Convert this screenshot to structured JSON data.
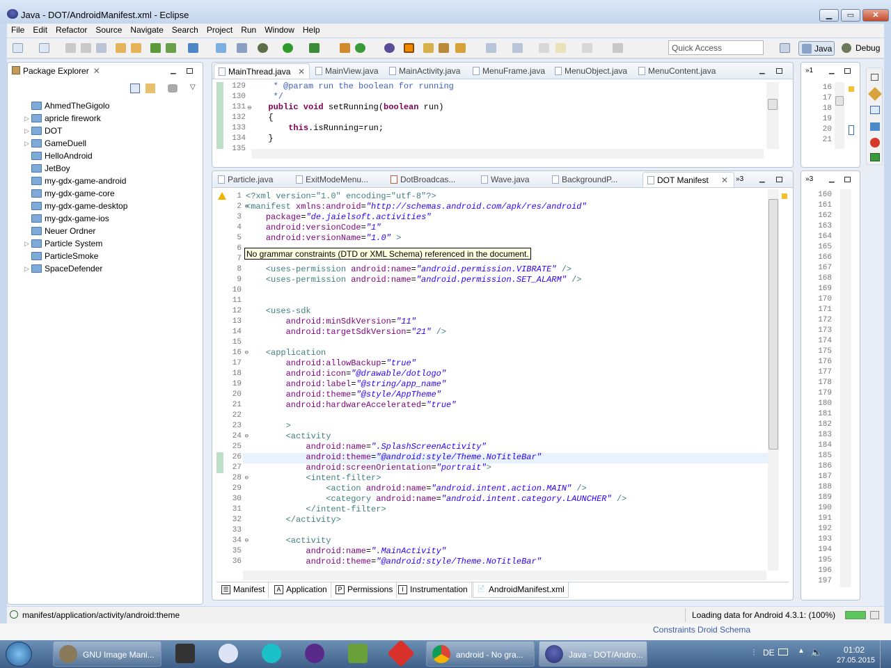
{
  "window": {
    "title": "Java - DOT/AndroidManifest.xml - Eclipse"
  },
  "menu": [
    "File",
    "Edit",
    "Refactor",
    "Source",
    "Navigate",
    "Search",
    "Project",
    "Run",
    "Window",
    "Help"
  ],
  "toolbar": {
    "quick_access": "Quick Access",
    "persp_java": "Java",
    "persp_debug": "Debug"
  },
  "package_explorer": {
    "title": "Package Explorer",
    "items": [
      {
        "label": "AhmedTheGigolo",
        "expandable": false
      },
      {
        "label": "apricle firework",
        "expandable": true
      },
      {
        "label": "DOT",
        "expandable": true
      },
      {
        "label": "GameDuell",
        "expandable": true
      },
      {
        "label": "HelloAndroid",
        "expandable": false
      },
      {
        "label": "JetBoy",
        "expandable": false
      },
      {
        "label": "my-gdx-game-android",
        "expandable": false
      },
      {
        "label": "my-gdx-game-core",
        "expandable": false
      },
      {
        "label": "my-gdx-game-desktop",
        "expandable": false
      },
      {
        "label": "my-gdx-game-ios",
        "expandable": false
      },
      {
        "label": "Neuer Ordner",
        "expandable": false
      },
      {
        "label": "Particle System",
        "expandable": true
      },
      {
        "label": "ParticleSmoke",
        "expandable": false
      },
      {
        "label": "SpaceDefender",
        "expandable": true
      }
    ]
  },
  "top_editor": {
    "tabs": [
      "MainThread.java",
      "MainView.java",
      "MainActivity.java",
      "MenuFrame.java",
      "MenuObject.java",
      "MenuContent.java"
    ],
    "lines": [
      "129",
      "130",
      "131",
      "132",
      "133",
      "134",
      "135"
    ],
    "code": [
      "   * @param run the boolean for running",
      "   */",
      "  public void setRunning(boolean run)",
      "  {",
      "      this.isRunning=run;",
      "  }",
      ""
    ]
  },
  "right_top": {
    "overflow": "1",
    "lines": [
      "16",
      "17",
      "18",
      "19",
      "20",
      "21"
    ]
  },
  "main_editor": {
    "tabs": [
      "Particle.java",
      "ExitModeMenu...",
      "DotBroadcas...",
      "Wave.java",
      "BackgroundP...",
      "DOT Manifest"
    ],
    "overflow": "3",
    "tooltip": "No grammar constraints (DTD or XML Schema) referenced in the document.",
    "lines": [
      "1",
      "2",
      "3",
      "4",
      "5",
      "6",
      "7",
      "8",
      "9",
      "10",
      "11",
      "12",
      "13",
      "14",
      "15",
      "16",
      "17",
      "18",
      "19",
      "20",
      "21",
      "22",
      "23",
      "24",
      "25",
      "26",
      "27",
      "28",
      "29",
      "30",
      "31",
      "32",
      "33",
      "34",
      "35",
      "36"
    ],
    "bottom_tabs": [
      "Manifest",
      "Application",
      "Permissions",
      "Instrumentation",
      "AndroidManifest.xml"
    ]
  },
  "right_bottom": {
    "overflow": "3",
    "lines": [
      "160",
      "161",
      "162",
      "163",
      "164",
      "165",
      "166",
      "167",
      "168",
      "169",
      "170",
      "171",
      "172",
      "173",
      "174",
      "175",
      "176",
      "177",
      "178",
      "179",
      "180",
      "181",
      "182",
      "183",
      "184",
      "185",
      "186",
      "187",
      "188",
      "189",
      "190",
      "191",
      "192",
      "193",
      "194",
      "195",
      "196",
      "197"
    ]
  },
  "status": {
    "left": "manifest/application/activity/android:theme",
    "right": "Loading data for Android 4.3.1: (100%)"
  },
  "taskbar": {
    "tasks": [
      "GNU Image Mani...",
      "android - No gra...",
      "Java - DOT/Andro..."
    ],
    "lang": "DE",
    "time": "01:02",
    "date": "27.05.2015",
    "bg_text": "Constraints Droid Schema"
  }
}
